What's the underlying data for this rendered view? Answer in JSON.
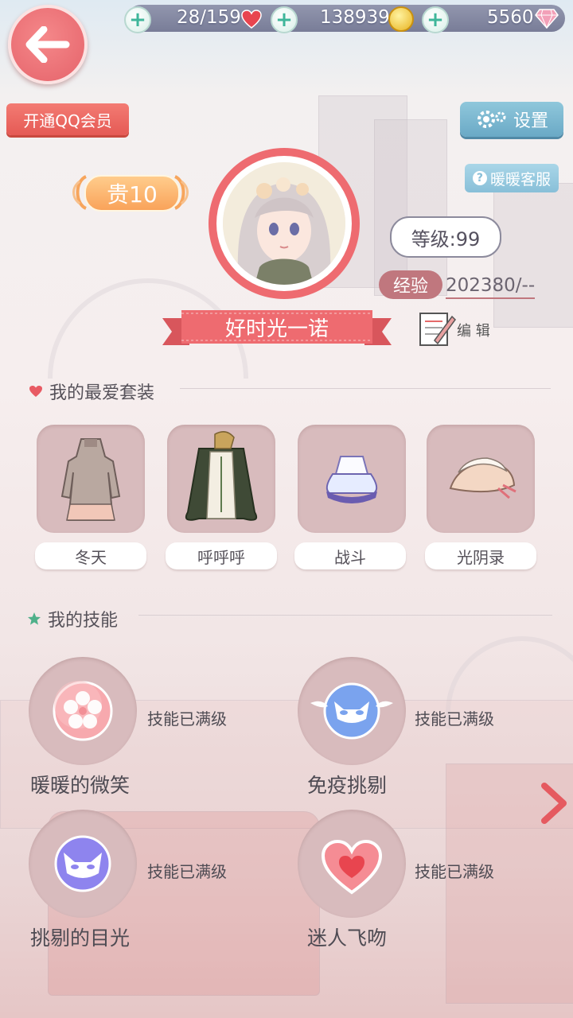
{
  "resources": {
    "stamina": "28/159",
    "coins": "138939",
    "diamonds": "5560"
  },
  "buttons": {
    "qq_member": "开通QQ会员",
    "settings": "设置",
    "customer_service": "暖暖客服",
    "edit": "编 辑"
  },
  "profile": {
    "vip": "贵10",
    "level": "等级:99",
    "exp_label": "经验",
    "exp_value": "202380/--",
    "name": "好时光一诺"
  },
  "favorites": {
    "title": "我的最爱套装",
    "items": [
      {
        "label": "冬天"
      },
      {
        "label": "呼呼呼"
      },
      {
        "label": "战斗"
      },
      {
        "label": "光阴录"
      }
    ]
  },
  "skills": {
    "title": "我的技能",
    "items": [
      {
        "name": "暖暖的微笑",
        "status": "技能已满级"
      },
      {
        "name": "免疫挑剔",
        "status": "技能已满级"
      },
      {
        "name": "挑剔的目光",
        "status": "技能已满级"
      },
      {
        "name": "迷人飞吻",
        "status": "技能已满级"
      }
    ]
  },
  "colors": {
    "accent_red": "#ee6b70",
    "card_bg": "#d8bbbd",
    "settings_blue": "#6aa9c6"
  }
}
